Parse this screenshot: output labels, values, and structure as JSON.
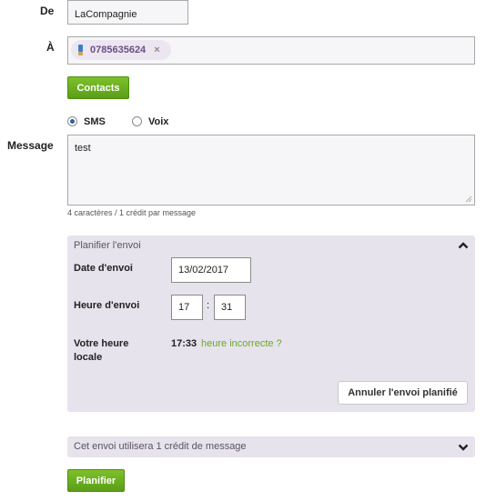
{
  "form": {
    "from": {
      "label": "De",
      "value": "LaCompagnie"
    },
    "to": {
      "label": "À",
      "recipient": "0785635624",
      "remove_symbol": "×"
    },
    "contacts_button": "Contacts",
    "mode": {
      "options": [
        {
          "label": "SMS",
          "selected": true
        },
        {
          "label": "Voix",
          "selected": false
        }
      ]
    },
    "message": {
      "label": "Message",
      "value": "test",
      "counter": "4 caractères /  1 crédit par message"
    }
  },
  "schedule_panel": {
    "title": "Planifier l'envoi",
    "expanded": true,
    "date_label": "Date d'envoi",
    "date_value": "13/02/2017",
    "time_label": "Heure d'envoi",
    "hour": "17",
    "separator": ":",
    "minute": "31",
    "local_time_label_line1": "Votre heure",
    "local_time_label_line2": "locale",
    "local_time_value": "17:33",
    "incorrect_time_link": "heure incorrecte ?",
    "cancel_button": "Annuler l'envoi planifié"
  },
  "credit_panel": {
    "title": "Cet envoi utilisera 1 crédit de message",
    "expanded": false
  },
  "submit_button": "Planifier",
  "colors": {
    "accent_green": "#6cb022",
    "link_green": "#6aa82a",
    "panel_bg": "#e6e3ec",
    "chip_bg": "#ece6f0"
  }
}
